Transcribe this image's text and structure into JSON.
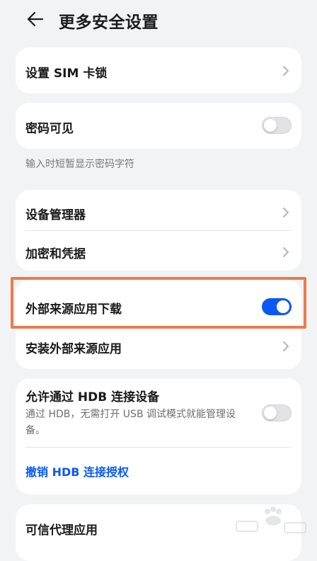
{
  "header": {
    "title": "更多安全设置",
    "back_icon": "arrow-left-icon"
  },
  "sim_lock": {
    "label": "设置 SIM 卡锁"
  },
  "password_visible": {
    "label": "密码可见",
    "enabled": false,
    "caption": "输入时短暂显示密码字符"
  },
  "device_management": {
    "items": [
      {
        "label": "设备管理器"
      },
      {
        "label": "加密和凭据"
      }
    ]
  },
  "external_sources": {
    "download_label": "外部来源应用下载",
    "download_enabled": true,
    "install_label": "安装外部来源应用"
  },
  "hdb": {
    "label": "允许通过 HDB 连接设备",
    "description": "通过 HDB，无需打开 USB 调试模式就能管理设备。",
    "enabled": false,
    "revoke_label": "撤销 HDB 连接授权"
  },
  "trust_agents": {
    "label": "可信代理应用"
  },
  "colors": {
    "accent": "#0a59f7",
    "highlight": "#ed7a4e",
    "background": "#f1f3f5"
  }
}
